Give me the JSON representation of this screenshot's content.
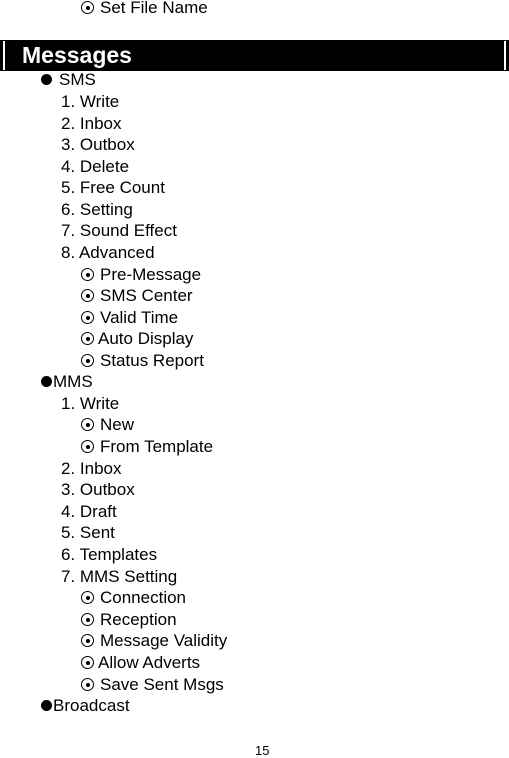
{
  "top_item": {
    "label": "Set File Name"
  },
  "section": {
    "title": "Messages"
  },
  "sms": {
    "label": "SMS",
    "items": [
      {
        "label": "1. Write"
      },
      {
        "label": "2. Inbox"
      },
      {
        "label": "3. Outbox"
      },
      {
        "label": "4. Delete"
      },
      {
        "label": "5. Free Count"
      },
      {
        "label": "6. Setting"
      },
      {
        "label": "7. Sound Effect"
      },
      {
        "label": "8. Advanced"
      }
    ],
    "advanced_subitems": [
      {
        "label": "Pre-Message"
      },
      {
        "label": "SMS Center"
      },
      {
        "label": "Valid Time"
      },
      {
        "label": "Auto Display"
      },
      {
        "label": "Status Report"
      }
    ]
  },
  "mms": {
    "label": "MMS",
    "write": {
      "label": "1. Write"
    },
    "write_subitems": [
      {
        "label": "New"
      },
      {
        "label": "From Template"
      }
    ],
    "items": [
      {
        "label": "2. Inbox"
      },
      {
        "label": "3. Outbox"
      },
      {
        "label": "4. Draft"
      },
      {
        "label": "5. Sent"
      },
      {
        "label": "6. Templates"
      },
      {
        "label": "7. MMS Setting"
      }
    ],
    "setting_subitems": [
      {
        "label": "Connection"
      },
      {
        "label": "Reception"
      },
      {
        "label": "Message Validity"
      },
      {
        "label": "Allow Adverts"
      },
      {
        "label": "Save Sent Msgs"
      }
    ]
  },
  "broadcast": {
    "label": "Broadcast"
  },
  "footer": {
    "page_number": "15"
  }
}
